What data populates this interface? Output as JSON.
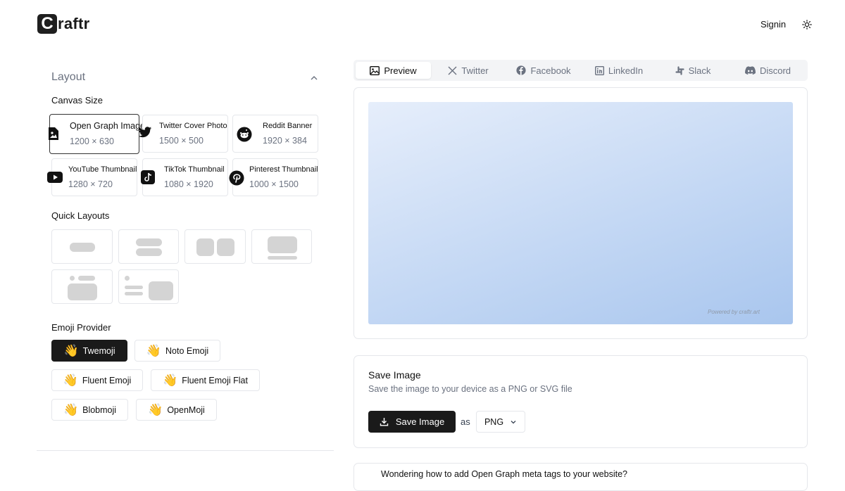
{
  "header": {
    "logo_letter": "C",
    "logo_text": "raftr",
    "signin_label": "Signin",
    "theme_icon": "sun-icon"
  },
  "layout_panel": {
    "title": "Layout",
    "canvas_size_label": "Canvas Size",
    "canvas_sizes": [
      {
        "name": "Open Graph Image",
        "size": "1200 × 630",
        "icon": "image-file-icon",
        "selected": true
      },
      {
        "name": "Twitter Cover Photo",
        "size": "1500 × 500",
        "icon": "twitter-icon",
        "selected": false
      },
      {
        "name": "Reddit Banner",
        "size": "1920 × 384",
        "icon": "reddit-icon",
        "selected": false
      },
      {
        "name": "YouTube Thumbnail",
        "size": "1280 × 720",
        "icon": "youtube-icon",
        "selected": false
      },
      {
        "name": "TikTok Thumbnail",
        "size": "1080 × 1920",
        "icon": "tiktok-icon",
        "selected": false
      },
      {
        "name": "Pinterest Thumbnail",
        "size": "1000 × 1500",
        "icon": "pinterest-icon",
        "selected": false
      }
    ],
    "quick_layouts_label": "Quick Layouts",
    "emoji_provider_label": "Emoji Provider",
    "emoji_providers": [
      {
        "label": "Twemoji",
        "glyph": "👋",
        "active": true
      },
      {
        "label": "Noto Emoji",
        "glyph": "👋",
        "active": false
      },
      {
        "label": "Fluent Emoji",
        "glyph": "👋",
        "active": false
      },
      {
        "label": "Fluent Emoji Flat",
        "glyph": "👋",
        "active": false
      },
      {
        "label": "Blobmoji",
        "glyph": "👋",
        "active": false
      },
      {
        "label": "OpenMoji",
        "glyph": "👋",
        "active": false
      }
    ]
  },
  "tabs": [
    {
      "label": "Preview",
      "icon": "image-icon",
      "active": true
    },
    {
      "label": "Twitter",
      "icon": "x-icon",
      "active": false
    },
    {
      "label": "Facebook",
      "icon": "facebook-icon",
      "active": false
    },
    {
      "label": "LinkedIn",
      "icon": "linkedin-icon",
      "active": false
    },
    {
      "label": "Slack",
      "icon": "slack-icon",
      "active": false
    },
    {
      "label": "Discord",
      "icon": "discord-icon",
      "active": false
    }
  ],
  "preview": {
    "powered_by": "Powered by craftr.art",
    "gradient_from": "#e6eefb",
    "gradient_to": "#a9c6ee"
  },
  "save": {
    "title": "Save Image",
    "description": "Save the image to your device as a PNG or SVG file",
    "button_label": "Save Image",
    "as_label": "as",
    "format_value": "PNG"
  },
  "faq": {
    "question": "Wondering how to add Open Graph meta tags to your website?"
  }
}
